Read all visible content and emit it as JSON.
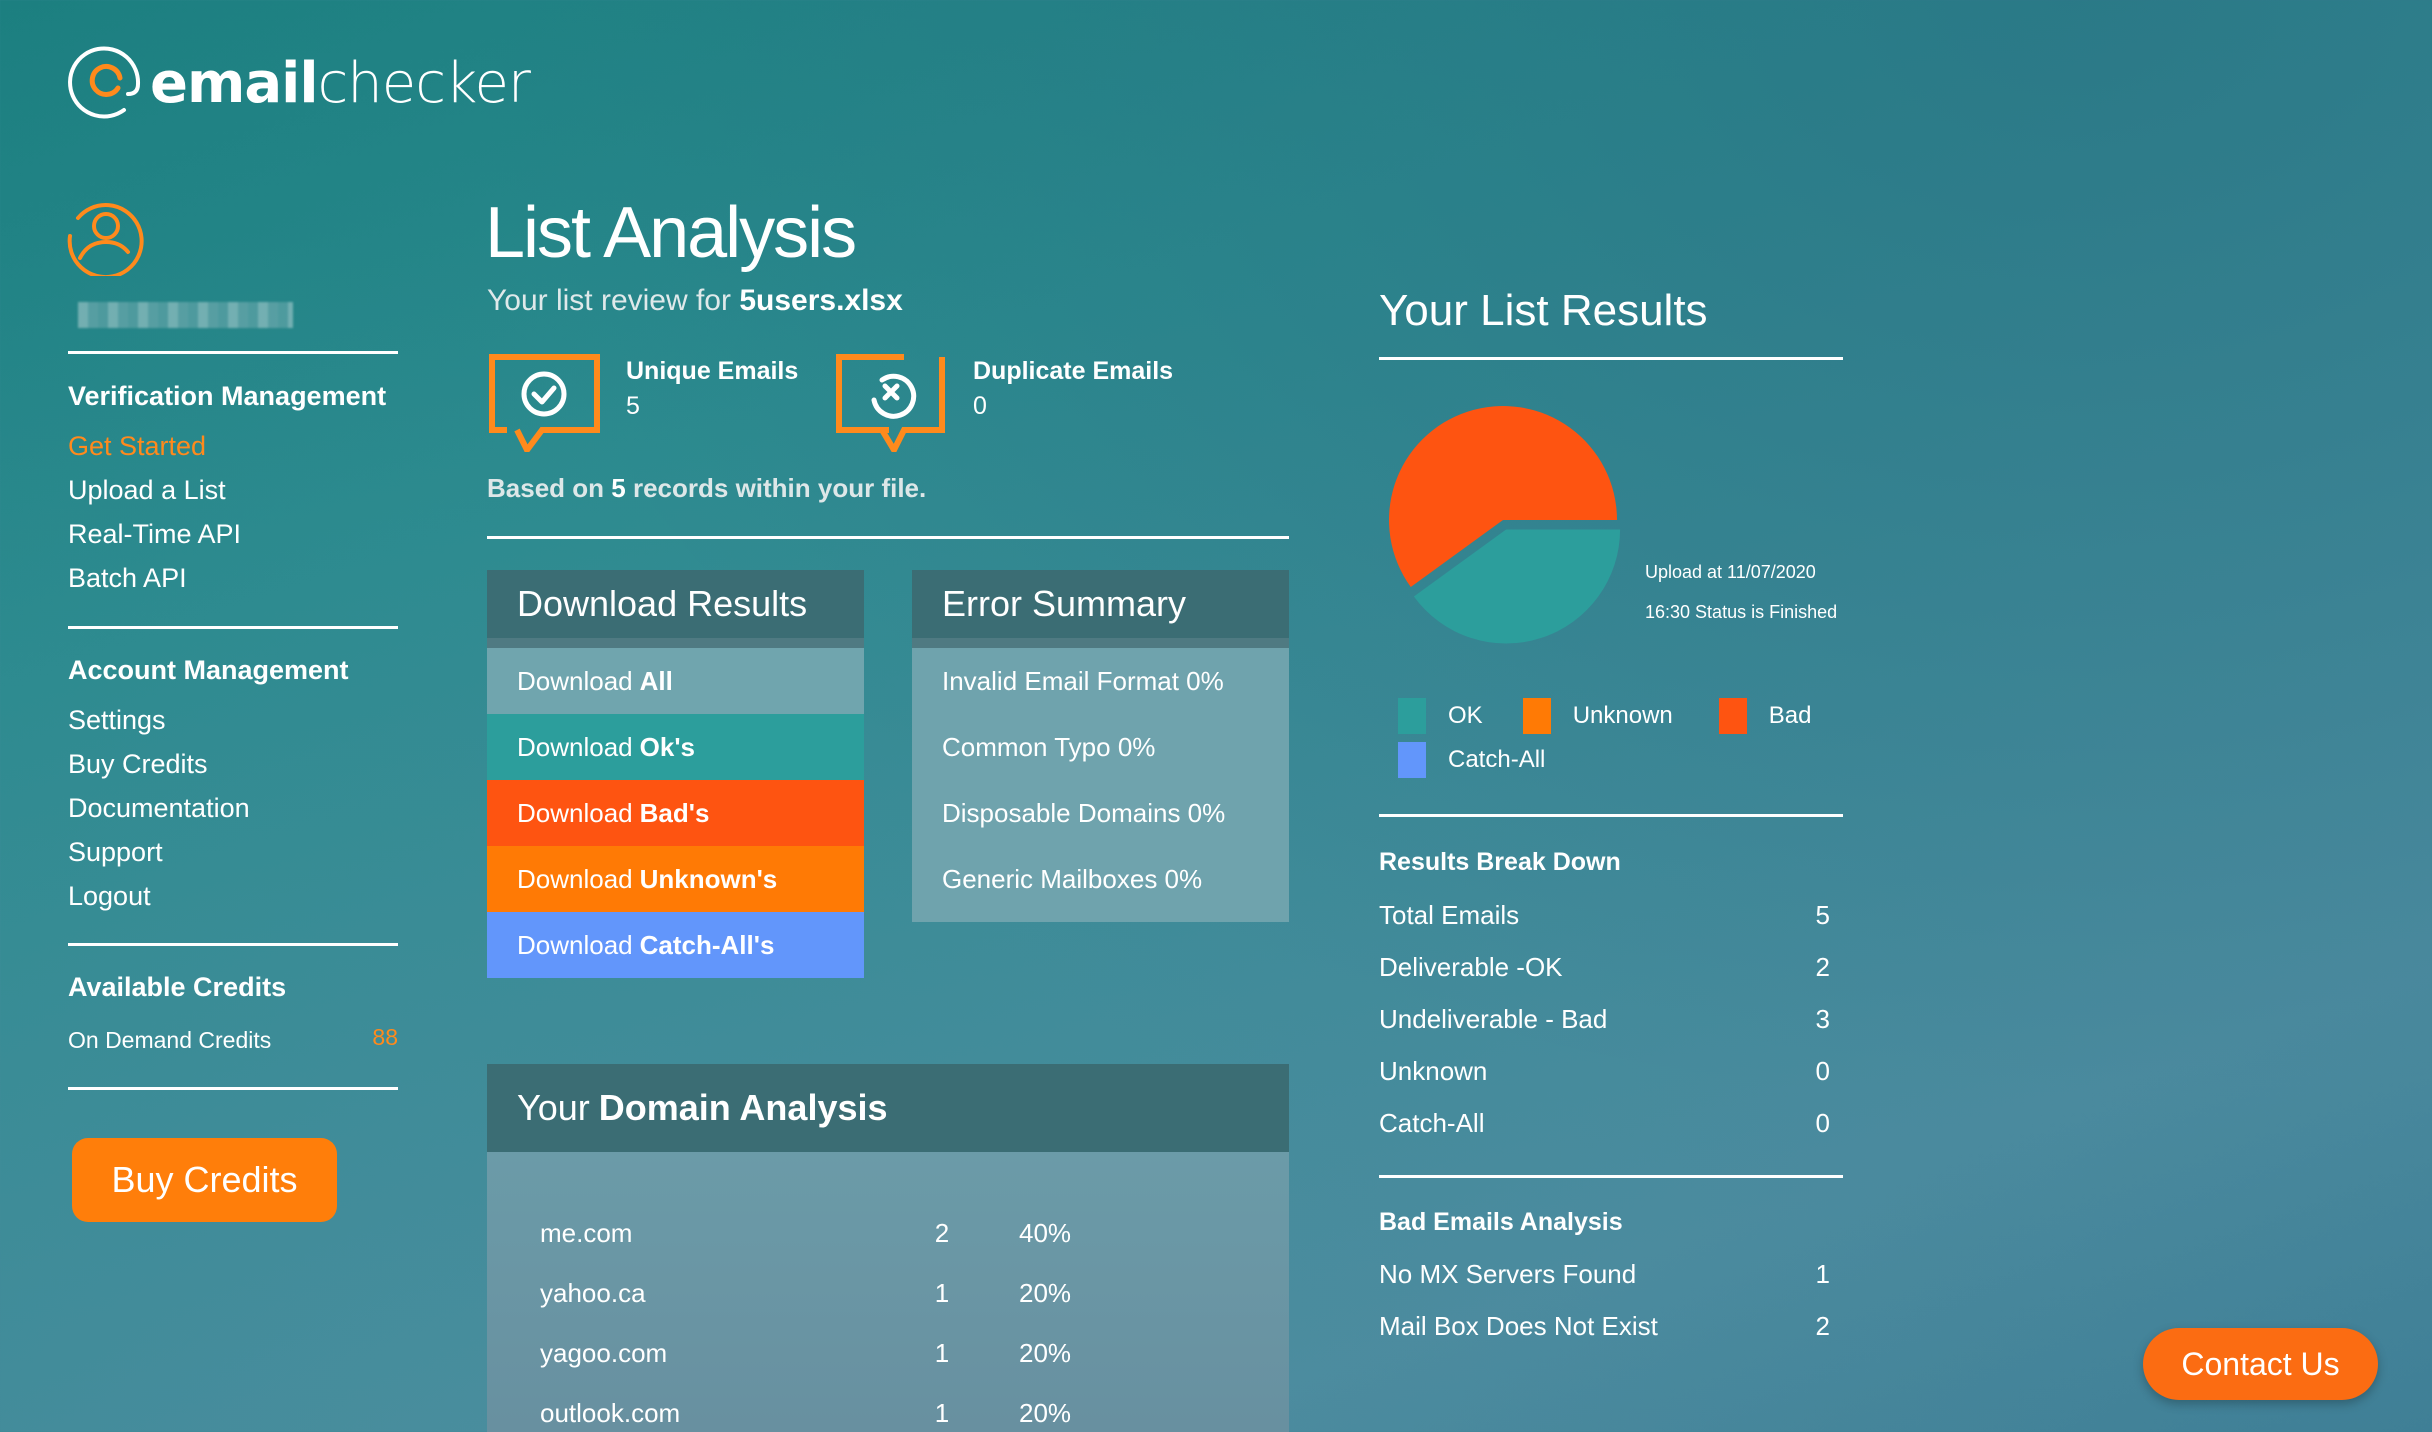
{
  "brand": {
    "name_bold": "email",
    "name_light": "checker",
    "accent": "#ff8a1c"
  },
  "sidebar": {
    "username": "",
    "sections": [
      {
        "heading": "Verification Management",
        "items": [
          {
            "label": "Get Started",
            "active": true
          },
          {
            "label": "Upload a List"
          },
          {
            "label": "Real-Time API"
          },
          {
            "label": "Batch API"
          }
        ]
      },
      {
        "heading": "Account Management",
        "items": [
          {
            "label": "Settings"
          },
          {
            "label": "Buy Credits"
          },
          {
            "label": "Documentation"
          },
          {
            "label": "Support"
          },
          {
            "label": "Logout"
          }
        ]
      }
    ],
    "credits": {
      "heading": "Available Credits",
      "label": "On Demand Credits",
      "value": "88"
    },
    "buy_button": "Buy Credits"
  },
  "main": {
    "title": "List Analysis",
    "subtitle_prefix": "Your list review for",
    "filename": "5users.xlsx",
    "stats": [
      {
        "label": "Unique Emails",
        "value": "5",
        "icon": "check-circle-icon"
      },
      {
        "label": "Duplicate Emails",
        "value": "0",
        "icon": "x-circle-icon"
      }
    ],
    "based_on": {
      "prefix": "Based on",
      "count": "5",
      "suffix": "records within your file."
    },
    "download": {
      "title": "Download Results",
      "rows": [
        {
          "prefix": "Download",
          "bold": "All",
          "color": "#70a5ae"
        },
        {
          "prefix": "Download",
          "bold": "Ok's",
          "color": "#2c9e9c"
        },
        {
          "prefix": "Download",
          "bold": "Bad's",
          "color": "#fe5411"
        },
        {
          "prefix": "Download",
          "bold": "Unknown's",
          "color": "#ff7a05"
        },
        {
          "prefix": "Download",
          "bold": "Catch-All's",
          "color": "#6296fb"
        }
      ]
    },
    "errors": {
      "title": "Error Summary",
      "rows": [
        "Invalid Email Format 0%",
        "Common Typo 0%",
        "Disposable Domains 0%",
        "Generic Mailboxes 0%"
      ]
    },
    "domains": {
      "title_prefix": "Your",
      "title_bold": "Domain Analysis",
      "rows": [
        {
          "domain": "me.com",
          "count": "2",
          "pct": "40%"
        },
        {
          "domain": "yahoo.ca",
          "count": "1",
          "pct": "20%"
        },
        {
          "domain": "yagoo.com",
          "count": "1",
          "pct": "20%"
        },
        {
          "domain": "outlook.com",
          "count": "1",
          "pct": "20%"
        }
      ]
    }
  },
  "results": {
    "title": "Your List Results",
    "upload_line1": "Upload at 11/07/2020",
    "upload_line2": "16:30 Status is Finished",
    "legend": [
      {
        "label": "OK",
        "color": "#2c9e9c"
      },
      {
        "label": "Unknown",
        "color": "#ff7a05"
      },
      {
        "label": "Bad",
        "color": "#fe5411"
      },
      {
        "label": "Catch-All",
        "color": "#6296fb"
      }
    ],
    "breakdown": {
      "heading": "Results Break Down",
      "rows": [
        {
          "label": "Total Emails",
          "value": "5"
        },
        {
          "label": "Deliverable -OK",
          "value": "2"
        },
        {
          "label": "Undeliverable - Bad",
          "value": "3"
        },
        {
          "label": "Unknown",
          "value": "0"
        },
        {
          "label": "Catch-All",
          "value": "0"
        }
      ]
    },
    "bad_analysis": {
      "heading": "Bad Emails Analysis",
      "rows": [
        {
          "label": "No MX Servers Found",
          "value": "1"
        },
        {
          "label": "Mail Box Does Not Exist",
          "value": "2"
        }
      ]
    }
  },
  "chart_data": {
    "type": "pie",
    "title": "",
    "categories": [
      "OK",
      "Unknown",
      "Bad",
      "Catch-All"
    ],
    "values": [
      2,
      0,
      3,
      0
    ],
    "colors": [
      "#2c9e9c",
      "#ff7a05",
      "#fe5411",
      "#6296fb"
    ],
    "exploded": [
      "OK"
    ],
    "legend": "bottom"
  },
  "contact_button": "Contact Us"
}
